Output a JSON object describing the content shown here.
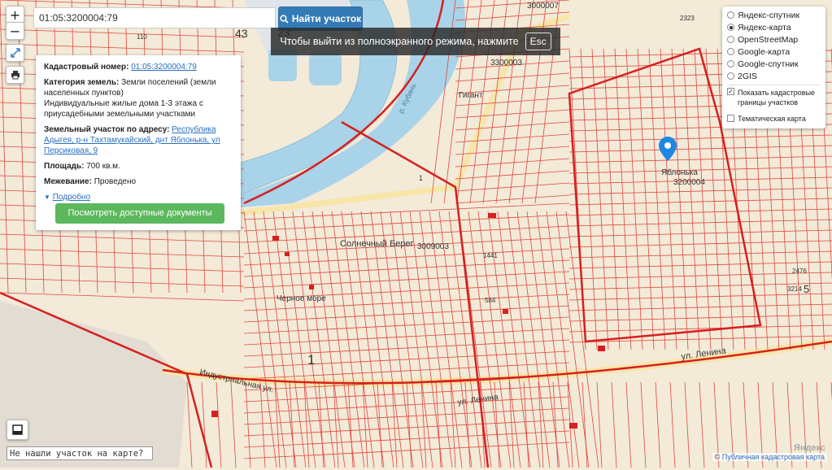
{
  "search": {
    "value": "01:05:3200004:79"
  },
  "find_button": {
    "label": "Найти участок",
    "icon": "search-icon"
  },
  "fullscreen_banner": {
    "text": "Чтобы выйти из полноэкранного режима, нажмите",
    "key": "Esc"
  },
  "zoom": {
    "plus": "+",
    "minus": "−"
  },
  "info": {
    "cadastral_label": "Кадастровый номер:",
    "cadastral_value": "01:05:3200004:79",
    "category_label": "Категория земель:",
    "category_value": "Земли поселений (земли населенных пунктов)",
    "use_value": "Индивидуальные жилые дома 1-3 этажа с приусадебными земельными участками",
    "address_label": "Земельный участок по адресу:",
    "address_value": "Республика Адыгея, р-н Тахтамукайский, днт Яблонька, ул Персиковая, 9",
    "area_label": "Площадь:",
    "area_value": "700 кв.м.",
    "survey_label": "Межевание:",
    "survey_value": "Проведено",
    "more_link": "Подробно",
    "docs_button": "Посмотреть доступные документы"
  },
  "layers": {
    "options": [
      {
        "label": "Яндекс-спутник",
        "selected": false
      },
      {
        "label": "Яндекс-карта",
        "selected": true
      },
      {
        "label": "OpenStreetMap",
        "selected": false
      },
      {
        "label": "Google-карта",
        "selected": false
      },
      {
        "label": "Google-спутник",
        "selected": false
      },
      {
        "label": "2GIS",
        "selected": false
      }
    ],
    "show_cadastral": {
      "label": "Показать кадастровые границы участков",
      "checked": true
    },
    "thematic": {
      "label": "Тематическая карта",
      "checked": false
    }
  },
  "map_labels": {
    "l1": "43",
    "l2": "23",
    "l3": "3000007",
    "l4": "3300003",
    "l5": "3200004",
    "l6": "Яблонька",
    "l7": "3200004",
    "l8": "Гигант",
    "l9": "Солнечный Берег",
    "l10": "3009003",
    "l11": "Черное море",
    "l12": "ул. Ленина",
    "l13": "ул. Ленина",
    "l14": "Индустриальная ул.",
    "l15": "р. Кубань",
    "l16": "2323",
    "l17": "5",
    "l18": "1",
    "l19": "3214",
    "l20": "2476",
    "l21": "1441",
    "l22": "110",
    "l23": "1",
    "l24": "584"
  },
  "not_found": "Не нашли участок на карте?",
  "attribution": {
    "prefix": "©",
    "link": "Публичная кадастровая карта",
    "watermark": "Яндекс"
  },
  "colors": {
    "accent": "#337ab7",
    "green": "#5cb85c",
    "parcel": "#e0473f",
    "river": "#a9d3e8",
    "land": "#f3ead8",
    "pin": "#1e88e5"
  }
}
